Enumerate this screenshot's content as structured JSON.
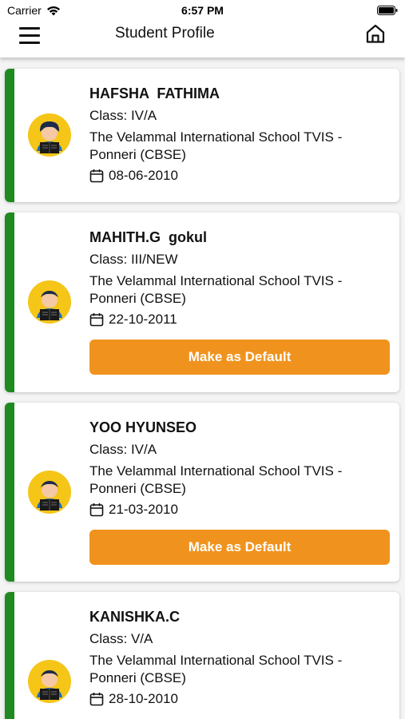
{
  "status_bar": {
    "carrier": "Carrier",
    "time": "6:57 PM"
  },
  "nav": {
    "title": "Student Profile"
  },
  "students": [
    {
      "name": "HAFSHA  FATHIMA",
      "class": "Class: IV/A",
      "school": "The Velammal International School TVIS - Ponneri (CBSE)",
      "dob": "08-06-2010",
      "button_label": ""
    },
    {
      "name": "MAHITH.G  gokul",
      "class": "Class: III/NEW",
      "school": "The Velammal International School TVIS - Ponneri (CBSE)",
      "dob": "22-10-2011",
      "button_label": "Make as Default"
    },
    {
      "name": "YOO HYUNSEO",
      "class": "Class: IV/A",
      "school": "The Velammal International School TVIS - Ponneri (CBSE)",
      "dob": "21-03-2010",
      "button_label": "Make as Default"
    },
    {
      "name": "KANISHKA.C",
      "class": "Class: V/A",
      "school": "The Velammal International School TVIS - Ponneri (CBSE)",
      "dob": "28-10-2010",
      "button_label": ""
    }
  ],
  "colors": {
    "accent_green": "#1f8a1f",
    "button_orange": "#f0931e",
    "avatar_yellow": "#f5c518"
  },
  "icons": {
    "menu": "hamburger-menu-icon",
    "home": "home-icon",
    "calendar": "calendar-icon",
    "avatar": "student-reading-avatar-icon"
  }
}
